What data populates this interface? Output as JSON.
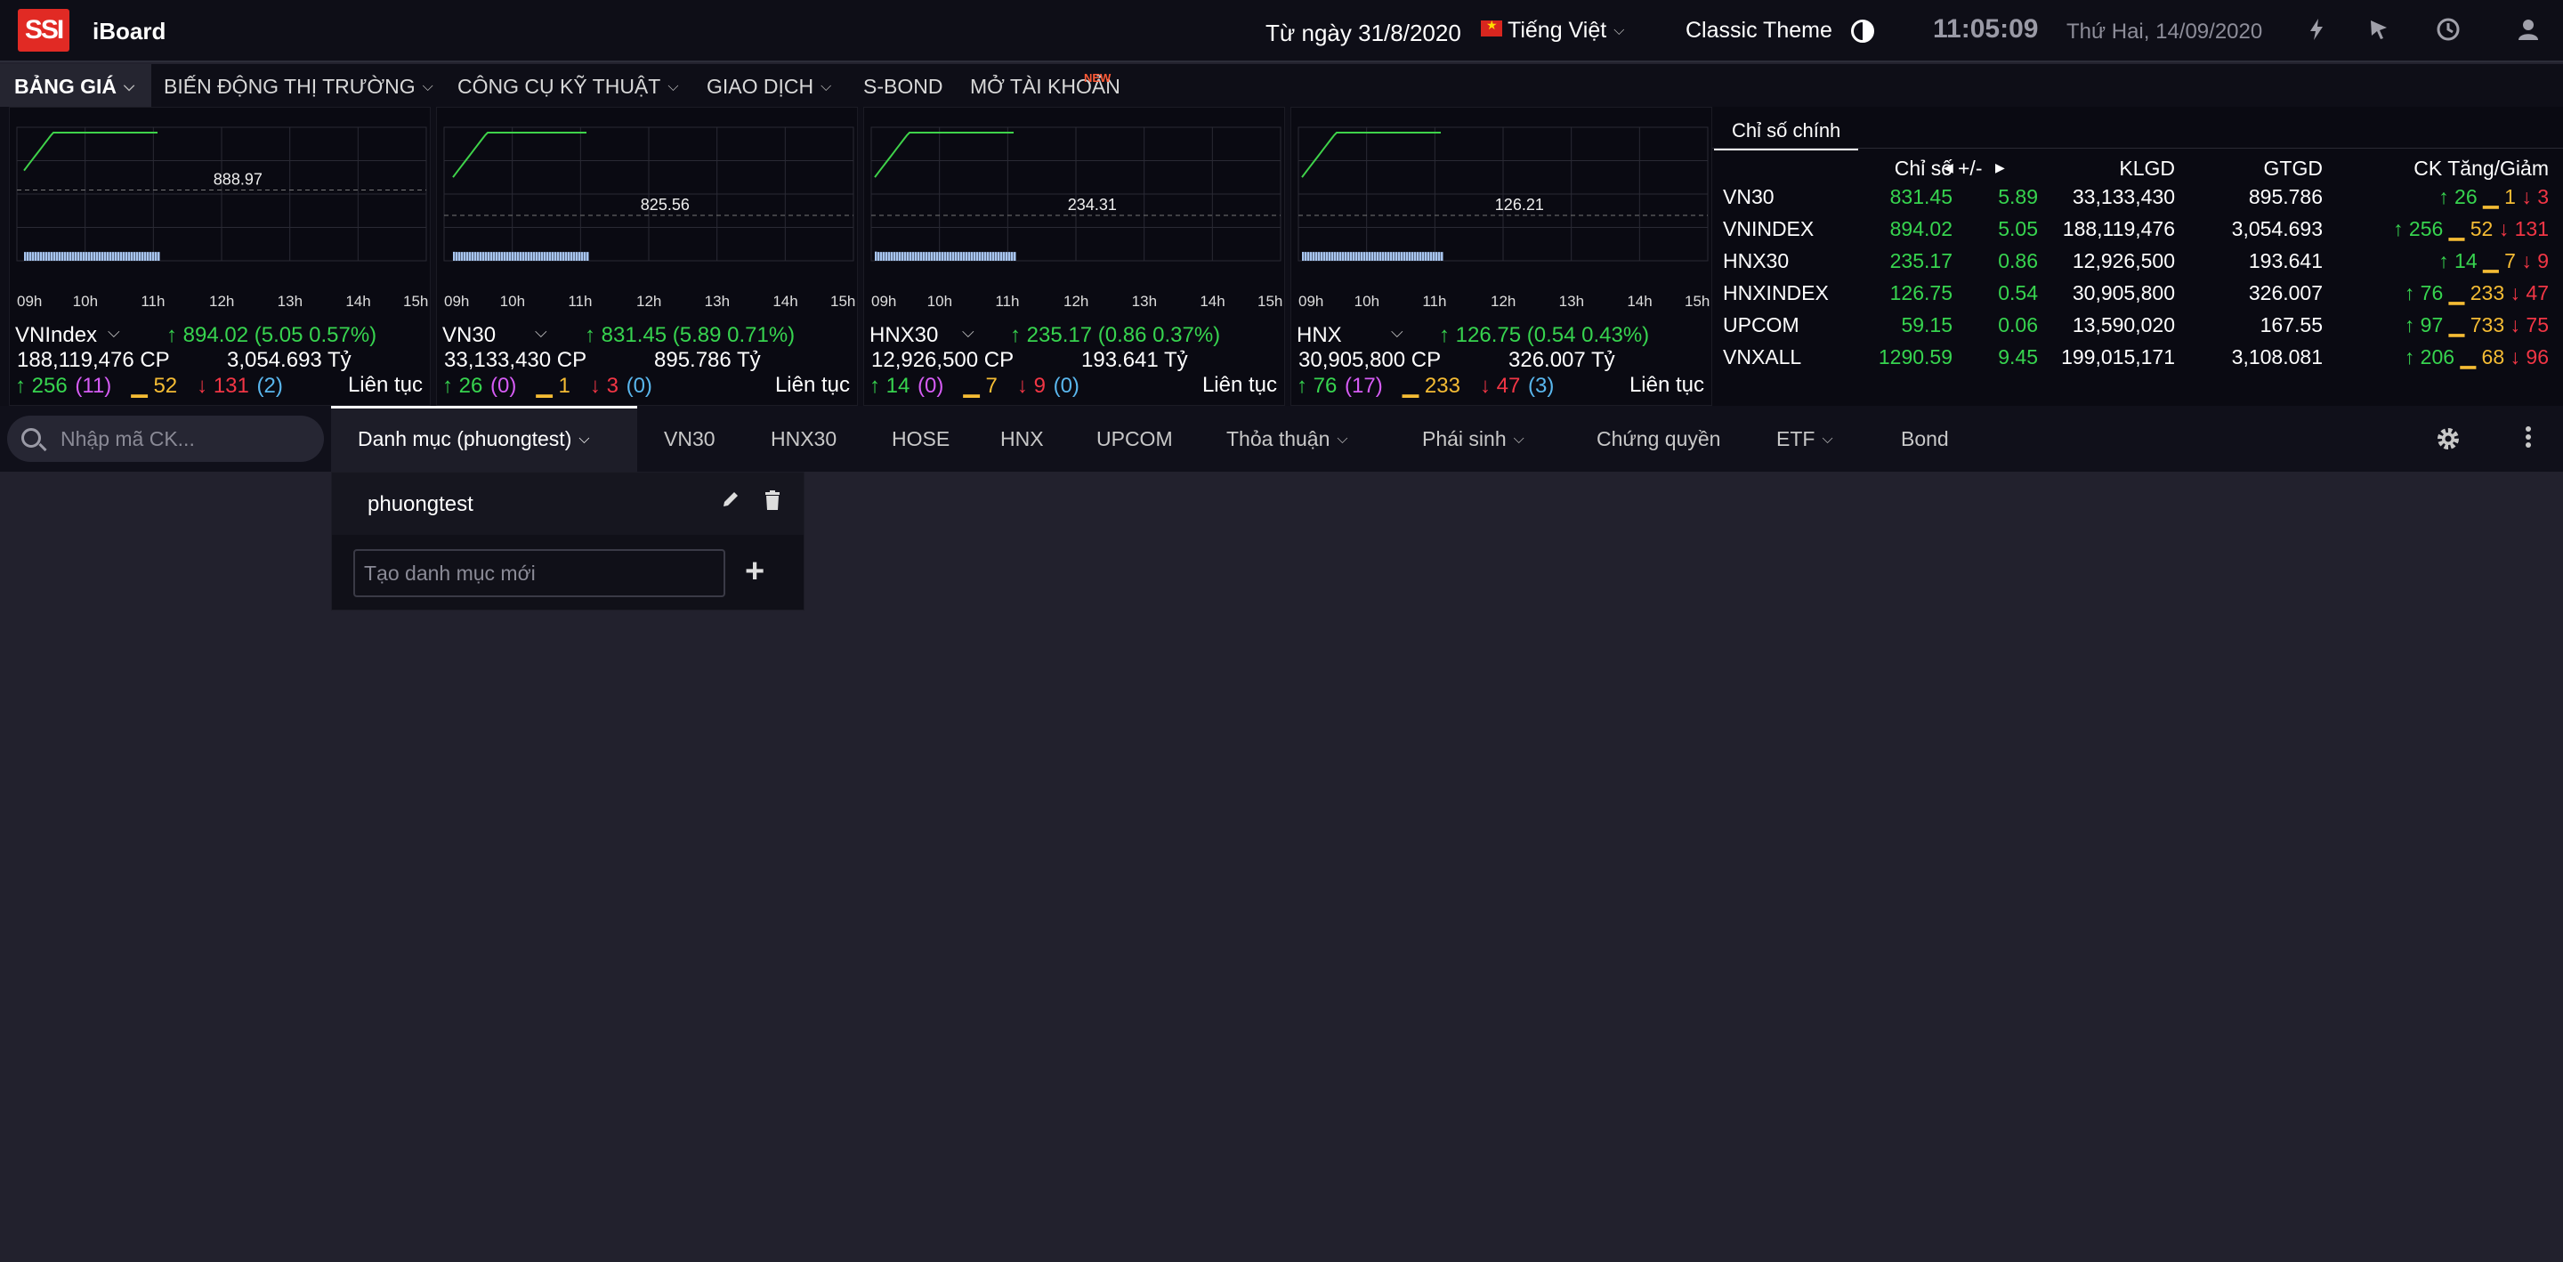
{
  "header": {
    "logo_text": "SSI",
    "app_name": "iBoard",
    "marquee_text": "Từ ngày 31/8/2020, SSI",
    "language": "Tiếng Việt",
    "theme": "Classic Theme",
    "clock": "11:05:09",
    "date": "Thứ Hai, 14/09/2020",
    "icons": [
      "contrast-icon",
      "flash-icon",
      "cursor-icon",
      "history-icon",
      "user-icon"
    ]
  },
  "nav": {
    "items": [
      {
        "label": "BẢNG GIÁ",
        "active": true,
        "dropdown": true
      },
      {
        "label": "BIẾN ĐỘNG THỊ TRƯỜNG",
        "active": false,
        "dropdown": true
      },
      {
        "label": "CÔNG CỤ KỸ THUẬT",
        "active": false,
        "dropdown": true
      },
      {
        "label": "GIAO DỊCH",
        "active": false,
        "dropdown": true
      },
      {
        "label": "S-BOND",
        "active": false,
        "dropdown": false
      },
      {
        "label": "MỞ TÀI KHOẢN",
        "active": false,
        "dropdown": false
      }
    ],
    "new_badge": "NEW"
  },
  "charts": [
    {
      "name": "VNIndex",
      "value": "894.02",
      "change": "(5.05",
      "pct": "0.57%)",
      "volume": "188,119,476 CP",
      "value_total": "3,054.693 Tỷ",
      "advances": "256",
      "ceiling": "(11)",
      "unchanged": "52",
      "declines": "131",
      "floor": "(2)",
      "market_status": "Liên tục",
      "reference": "888.97",
      "ticks": [
        "09h",
        "10h",
        "11h",
        "12h",
        "13h",
        "14h",
        "15h"
      ]
    },
    {
      "name": "VN30",
      "value": "831.45",
      "change": "(5.89",
      "pct": "0.71%)",
      "volume": "33,133,430 CP",
      "value_total": "895.786 Tỷ",
      "advances": "26",
      "ceiling": "(0)",
      "unchanged": "1",
      "declines": "3",
      "floor": "(0)",
      "market_status": "Liên tục",
      "reference": "825.56",
      "ticks": [
        "09h",
        "10h",
        "11h",
        "12h",
        "13h",
        "14h",
        "15h"
      ]
    },
    {
      "name": "HNX30",
      "value": "235.17",
      "change": "(0.86",
      "pct": "0.37%)",
      "volume": "12,926,500 CP",
      "value_total": "193.641 Tỷ",
      "advances": "14",
      "ceiling": "(0)",
      "unchanged": "7",
      "declines": "9",
      "floor": "(0)",
      "market_status": "Liên tục",
      "reference": "234.31",
      "ticks": [
        "09h",
        "10h",
        "11h",
        "12h",
        "13h",
        "14h",
        "15h"
      ]
    },
    {
      "name": "HNX",
      "value": "126.75",
      "change": "(0.54",
      "pct": "0.43%)",
      "volume": "30,905,800 CP",
      "value_total": "326.007 Tỷ",
      "advances": "76",
      "ceiling": "(17)",
      "unchanged": "233",
      "declines": "47",
      "floor": "(3)",
      "market_status": "Liên tục",
      "reference": "126.21",
      "ticks": [
        "09h",
        "10h",
        "11h",
        "12h",
        "13h",
        "14h",
        "15h"
      ]
    }
  ],
  "index_table": {
    "tab_label": "Chỉ số chính",
    "headers": {
      "index": "Chỉ số",
      "change": "+/-",
      "volume": "KLGD",
      "value": "GTGD",
      "breadth": "CK Tăng/Giảm"
    },
    "rows": [
      {
        "name": "VN30",
        "index": "831.45",
        "change": "5.89",
        "volume": "33,133,430",
        "value": "895.786",
        "up": "26",
        "same": "1",
        "down": "3"
      },
      {
        "name": "VNINDEX",
        "index": "894.02",
        "change": "5.05",
        "volume": "188,119,476",
        "value": "3,054.693",
        "up": "256",
        "same": "52",
        "down": "131"
      },
      {
        "name": "HNX30",
        "index": "235.17",
        "change": "0.86",
        "volume": "12,926,500",
        "value": "193.641",
        "up": "14",
        "same": "7",
        "down": "9"
      },
      {
        "name": "HNXINDEX",
        "index": "126.75",
        "change": "0.54",
        "volume": "30,905,800",
        "value": "326.007",
        "up": "76",
        "same": "233",
        "down": "47"
      },
      {
        "name": "UPCOM",
        "index": "59.15",
        "change": "0.06",
        "volume": "13,590,020",
        "value": "167.55",
        "up": "97",
        "same": "733",
        "down": "75"
      },
      {
        "name": "VNXALL",
        "index": "1290.59",
        "change": "9.45",
        "volume": "199,015,171",
        "value": "3,108.081",
        "up": "206",
        "same": "68",
        "down": "96"
      }
    ]
  },
  "toolbar": {
    "search_placeholder": "Nhập mã CK...",
    "tabs": [
      {
        "label": "Danh mục (phuongtest)",
        "active": true,
        "dropdown": true
      },
      {
        "label": "VN30",
        "active": false,
        "dropdown": false
      },
      {
        "label": "HNX30",
        "active": false,
        "dropdown": false
      },
      {
        "label": "HOSE",
        "active": false,
        "dropdown": false
      },
      {
        "label": "HNX",
        "active": false,
        "dropdown": false
      },
      {
        "label": "UPCOM",
        "active": false,
        "dropdown": false
      },
      {
        "label": "Thỏa thuận",
        "active": false,
        "dropdown": true
      },
      {
        "label": "Phái sinh",
        "active": false,
        "dropdown": true
      },
      {
        "label": "Chứng quyền",
        "active": false,
        "dropdown": false
      },
      {
        "label": "ETF",
        "active": false,
        "dropdown": true
      },
      {
        "label": "Bond",
        "active": false,
        "dropdown": false
      }
    ]
  },
  "watchlist_dropdown": {
    "item": "phuongtest",
    "new_placeholder": "Tạo danh mục mới"
  },
  "colors": {
    "up": "#37d44f",
    "reference": "#f5bc34",
    "down": "#f23645",
    "ceiling": "#d65cf5",
    "floor": "#5ab7ee",
    "brand": "#e12a24"
  }
}
